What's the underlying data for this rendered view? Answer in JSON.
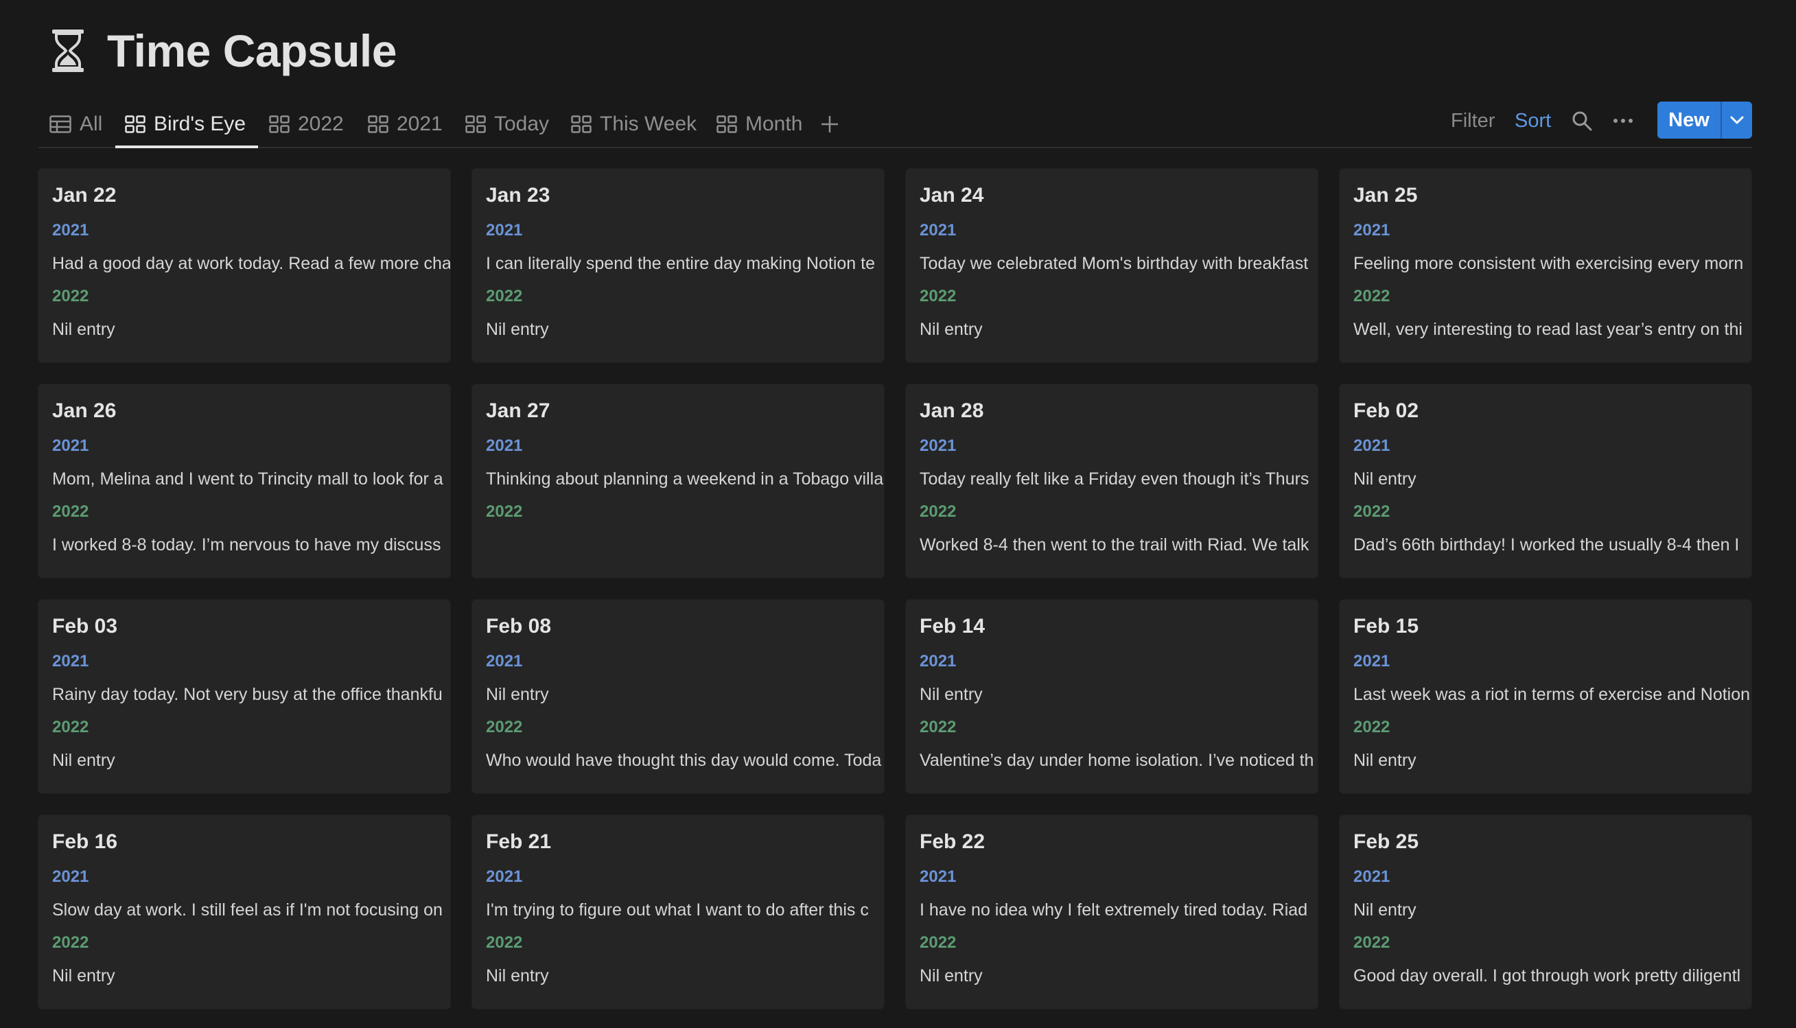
{
  "page": {
    "title": "Time Capsule",
    "icon": "hourglass-icon"
  },
  "tabs": [
    {
      "label": "All",
      "icon": "table-icon",
      "active": false
    },
    {
      "label": "Bird's Eye",
      "icon": "gallery-icon",
      "active": true
    },
    {
      "label": "2022",
      "icon": "gallery-icon",
      "active": false
    },
    {
      "label": "2021",
      "icon": "gallery-icon",
      "active": false
    },
    {
      "label": "Today",
      "icon": "gallery-icon",
      "active": false
    },
    {
      "label": "This Week",
      "icon": "gallery-icon",
      "active": false
    },
    {
      "label": "Month",
      "icon": "gallery-icon",
      "active": false
    }
  ],
  "toolbar": {
    "filter_label": "Filter",
    "sort_label": "Sort",
    "new_label": "New",
    "icons": [
      "add-view-icon",
      "search-icon",
      "more-icon",
      "chevron-down-icon"
    ]
  },
  "colors": {
    "background": "#191919",
    "card": "#252525",
    "accent": "#2f7ddb",
    "year_2021": "#6b93d6",
    "year_2022": "#5c9c73"
  },
  "cards": [
    {
      "date": "Jan 22",
      "y1": "2021",
      "e1": "Had a good day at work today. Read a few more cha",
      "y2": "2022",
      "e2": "Nil entry"
    },
    {
      "date": "Jan 23",
      "y1": "2021",
      "e1": "I can literally spend the entire day making Notion te",
      "y2": "2022",
      "e2": "Nil entry"
    },
    {
      "date": "Jan 24",
      "y1": "2021",
      "e1": "Today we celebrated Mom's birthday with breakfast",
      "y2": "2022",
      "e2": "Nil entry"
    },
    {
      "date": "Jan 25",
      "y1": "2021",
      "e1": "Feeling more consistent with exercising every morn",
      "y2": "2022",
      "e2": "Well, very interesting to read last year’s entry on thi"
    },
    {
      "date": "Jan 26",
      "y1": "2021",
      "e1": "Mom, Melina and I went to Trincity mall to look for a",
      "y2": "2022",
      "e2": "I worked 8-8 today. I’m nervous to have my discuss"
    },
    {
      "date": "Jan 27",
      "y1": "2021",
      "e1": "Thinking about planning a weekend in a Tobago villa",
      "y2": "2022",
      "e2": ""
    },
    {
      "date": "Jan 28",
      "y1": "2021",
      "e1": "Today really felt like a Friday even though it’s Thurs",
      "y2": "2022",
      "e2": "Worked 8-4 then went to the trail with Riad. We talk"
    },
    {
      "date": "Feb 02",
      "y1": "2021",
      "e1": "Nil entry",
      "y2": "2022",
      "e2": "Dad’s 66th birthday! I worked the usually 8-4 then I"
    },
    {
      "date": "Feb 03",
      "y1": "2021",
      "e1": "Rainy day today. Not very busy at the office thankfu",
      "y2": "2022",
      "e2": "Nil entry"
    },
    {
      "date": "Feb 08",
      "y1": "2021",
      "e1": "Nil entry",
      "y2": "2022",
      "e2": "Who would have thought this day would come. Toda"
    },
    {
      "date": "Feb 14",
      "y1": "2021",
      "e1": "Nil entry",
      "y2": "2022",
      "e2": "Valentine’s day under home isolation. I’ve noticed th"
    },
    {
      "date": "Feb 15",
      "y1": "2021",
      "e1": "Last week was a riot in terms of exercise and Notion",
      "y2": "2022",
      "e2": "Nil entry"
    },
    {
      "date": "Feb 16",
      "y1": "2021",
      "e1": "Slow day at work. I still feel as if I'm not focusing on",
      "y2": "2022",
      "e2": "Nil entry"
    },
    {
      "date": "Feb 21",
      "y1": "2021",
      "e1": "I'm trying to figure out what I want to do after this c",
      "y2": "2022",
      "e2": "Nil entry"
    },
    {
      "date": "Feb 22",
      "y1": "2021",
      "e1": "I have no idea why I felt extremely tired today. Riad",
      "y2": "2022",
      "e2": "Nil entry"
    },
    {
      "date": "Feb 25",
      "y1": "2021",
      "e1": "Nil entry",
      "y2": "2022",
      "e2": "Good day overall. I got through work pretty diligentl"
    }
  ]
}
